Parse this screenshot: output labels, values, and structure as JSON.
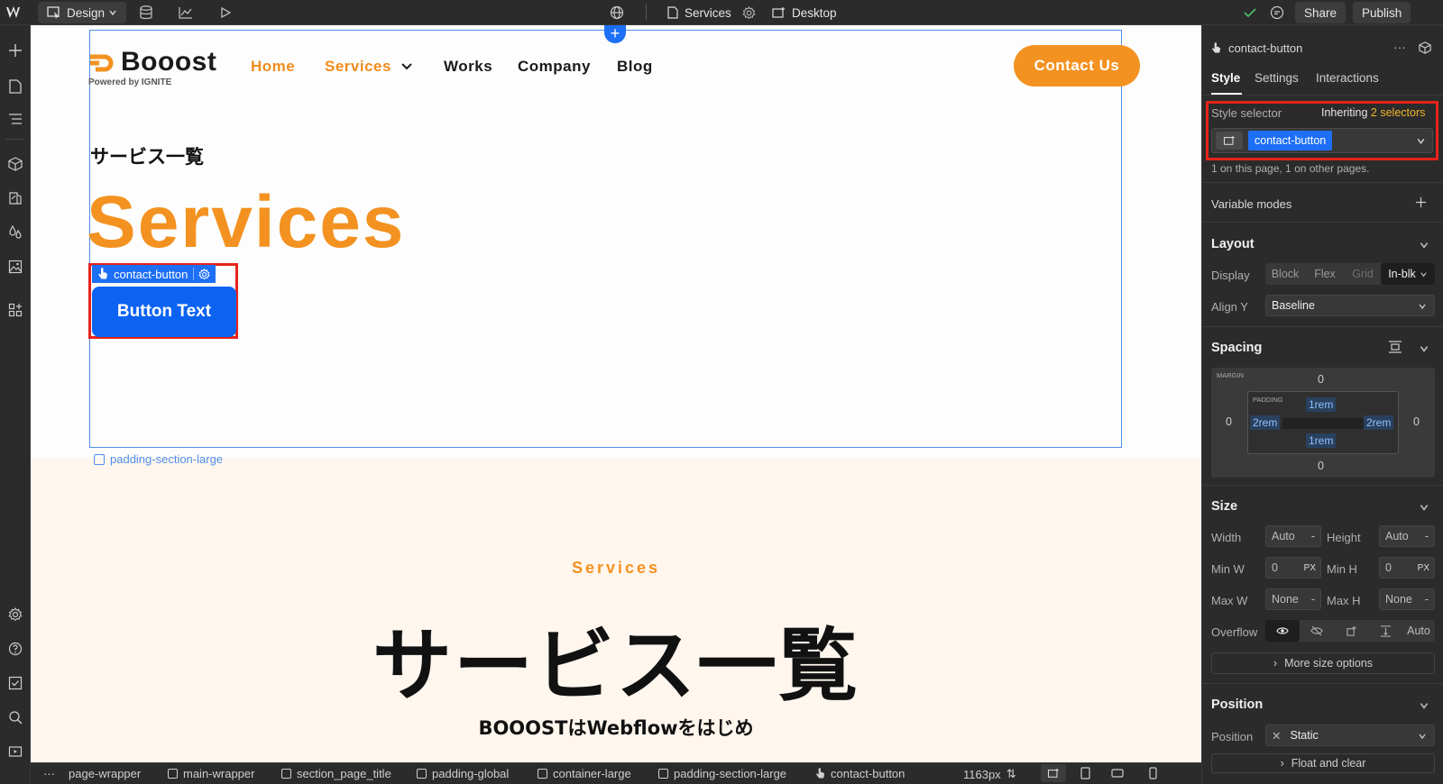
{
  "topbar": {
    "mode_label": "Design",
    "page_label": "Services",
    "breakpoint_label": "Desktop",
    "share_label": "Share",
    "publish_label": "Publish"
  },
  "canvas": {
    "logo_text": "Booost",
    "logo_sub": "Powered by IGNITE",
    "nav": [
      "Home",
      "Services",
      "Works",
      "Company",
      "Blog"
    ],
    "contact_label": "Contact Us",
    "jp_heading": "サービス一覧",
    "big_title": "Services",
    "selected_tag": "contact-button",
    "button_text": "Button Text",
    "padding_label": "padding-section-large",
    "section2_eyebrow": "Services",
    "section2_title": "サービス一覧",
    "section2_sub": "BOOOSTはWebflowをはじめ"
  },
  "panel": {
    "element_name": "contact-button",
    "tabs": [
      "Style",
      "Settings",
      "Interactions"
    ],
    "style_selector_label": "Style selector",
    "inheriting_text": "Inheriting",
    "inheriting_count": "2 selectors",
    "selector_chip": "contact-button",
    "usage_text": "1 on this page, 1 on other pages.",
    "variable_modes": "Variable modes",
    "layout": {
      "heading": "Layout",
      "display_label": "Display",
      "display_options": [
        "Block",
        "Flex",
        "Grid",
        "In-blk"
      ],
      "align_label": "Align Y",
      "align_value": "Baseline"
    },
    "spacing": {
      "heading": "Spacing",
      "margin_label": "MARGIN",
      "padding_label": "PADDING",
      "margin_top": "0",
      "margin_left": "0",
      "margin_right": "0",
      "margin_bottom": "0",
      "padding_top": "1rem",
      "padding_left": "2rem",
      "padding_right": "2rem",
      "padding_bottom": "1rem"
    },
    "size": {
      "heading": "Size",
      "width_label": "Width",
      "width_value": "Auto",
      "height_label": "Height",
      "height_value": "Auto",
      "minw_label": "Min W",
      "minw_value": "0",
      "minw_unit": "PX",
      "minh_label": "Min H",
      "minh_value": "0",
      "minh_unit": "PX",
      "maxw_label": "Max W",
      "maxw_value": "None",
      "maxh_label": "Max H",
      "maxh_value": "None",
      "overflow_label": "Overflow",
      "overflow_auto": "Auto",
      "more_label": "More size options",
      "dash": "-"
    },
    "position": {
      "heading": "Position",
      "position_label": "Position",
      "position_value": "Static",
      "float_label": "Float and clear"
    }
  },
  "bottombar": {
    "crumbs": [
      "page-wrapper",
      "main-wrapper",
      "section_page_title",
      "padding-global",
      "container-large",
      "padding-section-large",
      "contact-button"
    ],
    "width_readout": "1163px"
  }
}
